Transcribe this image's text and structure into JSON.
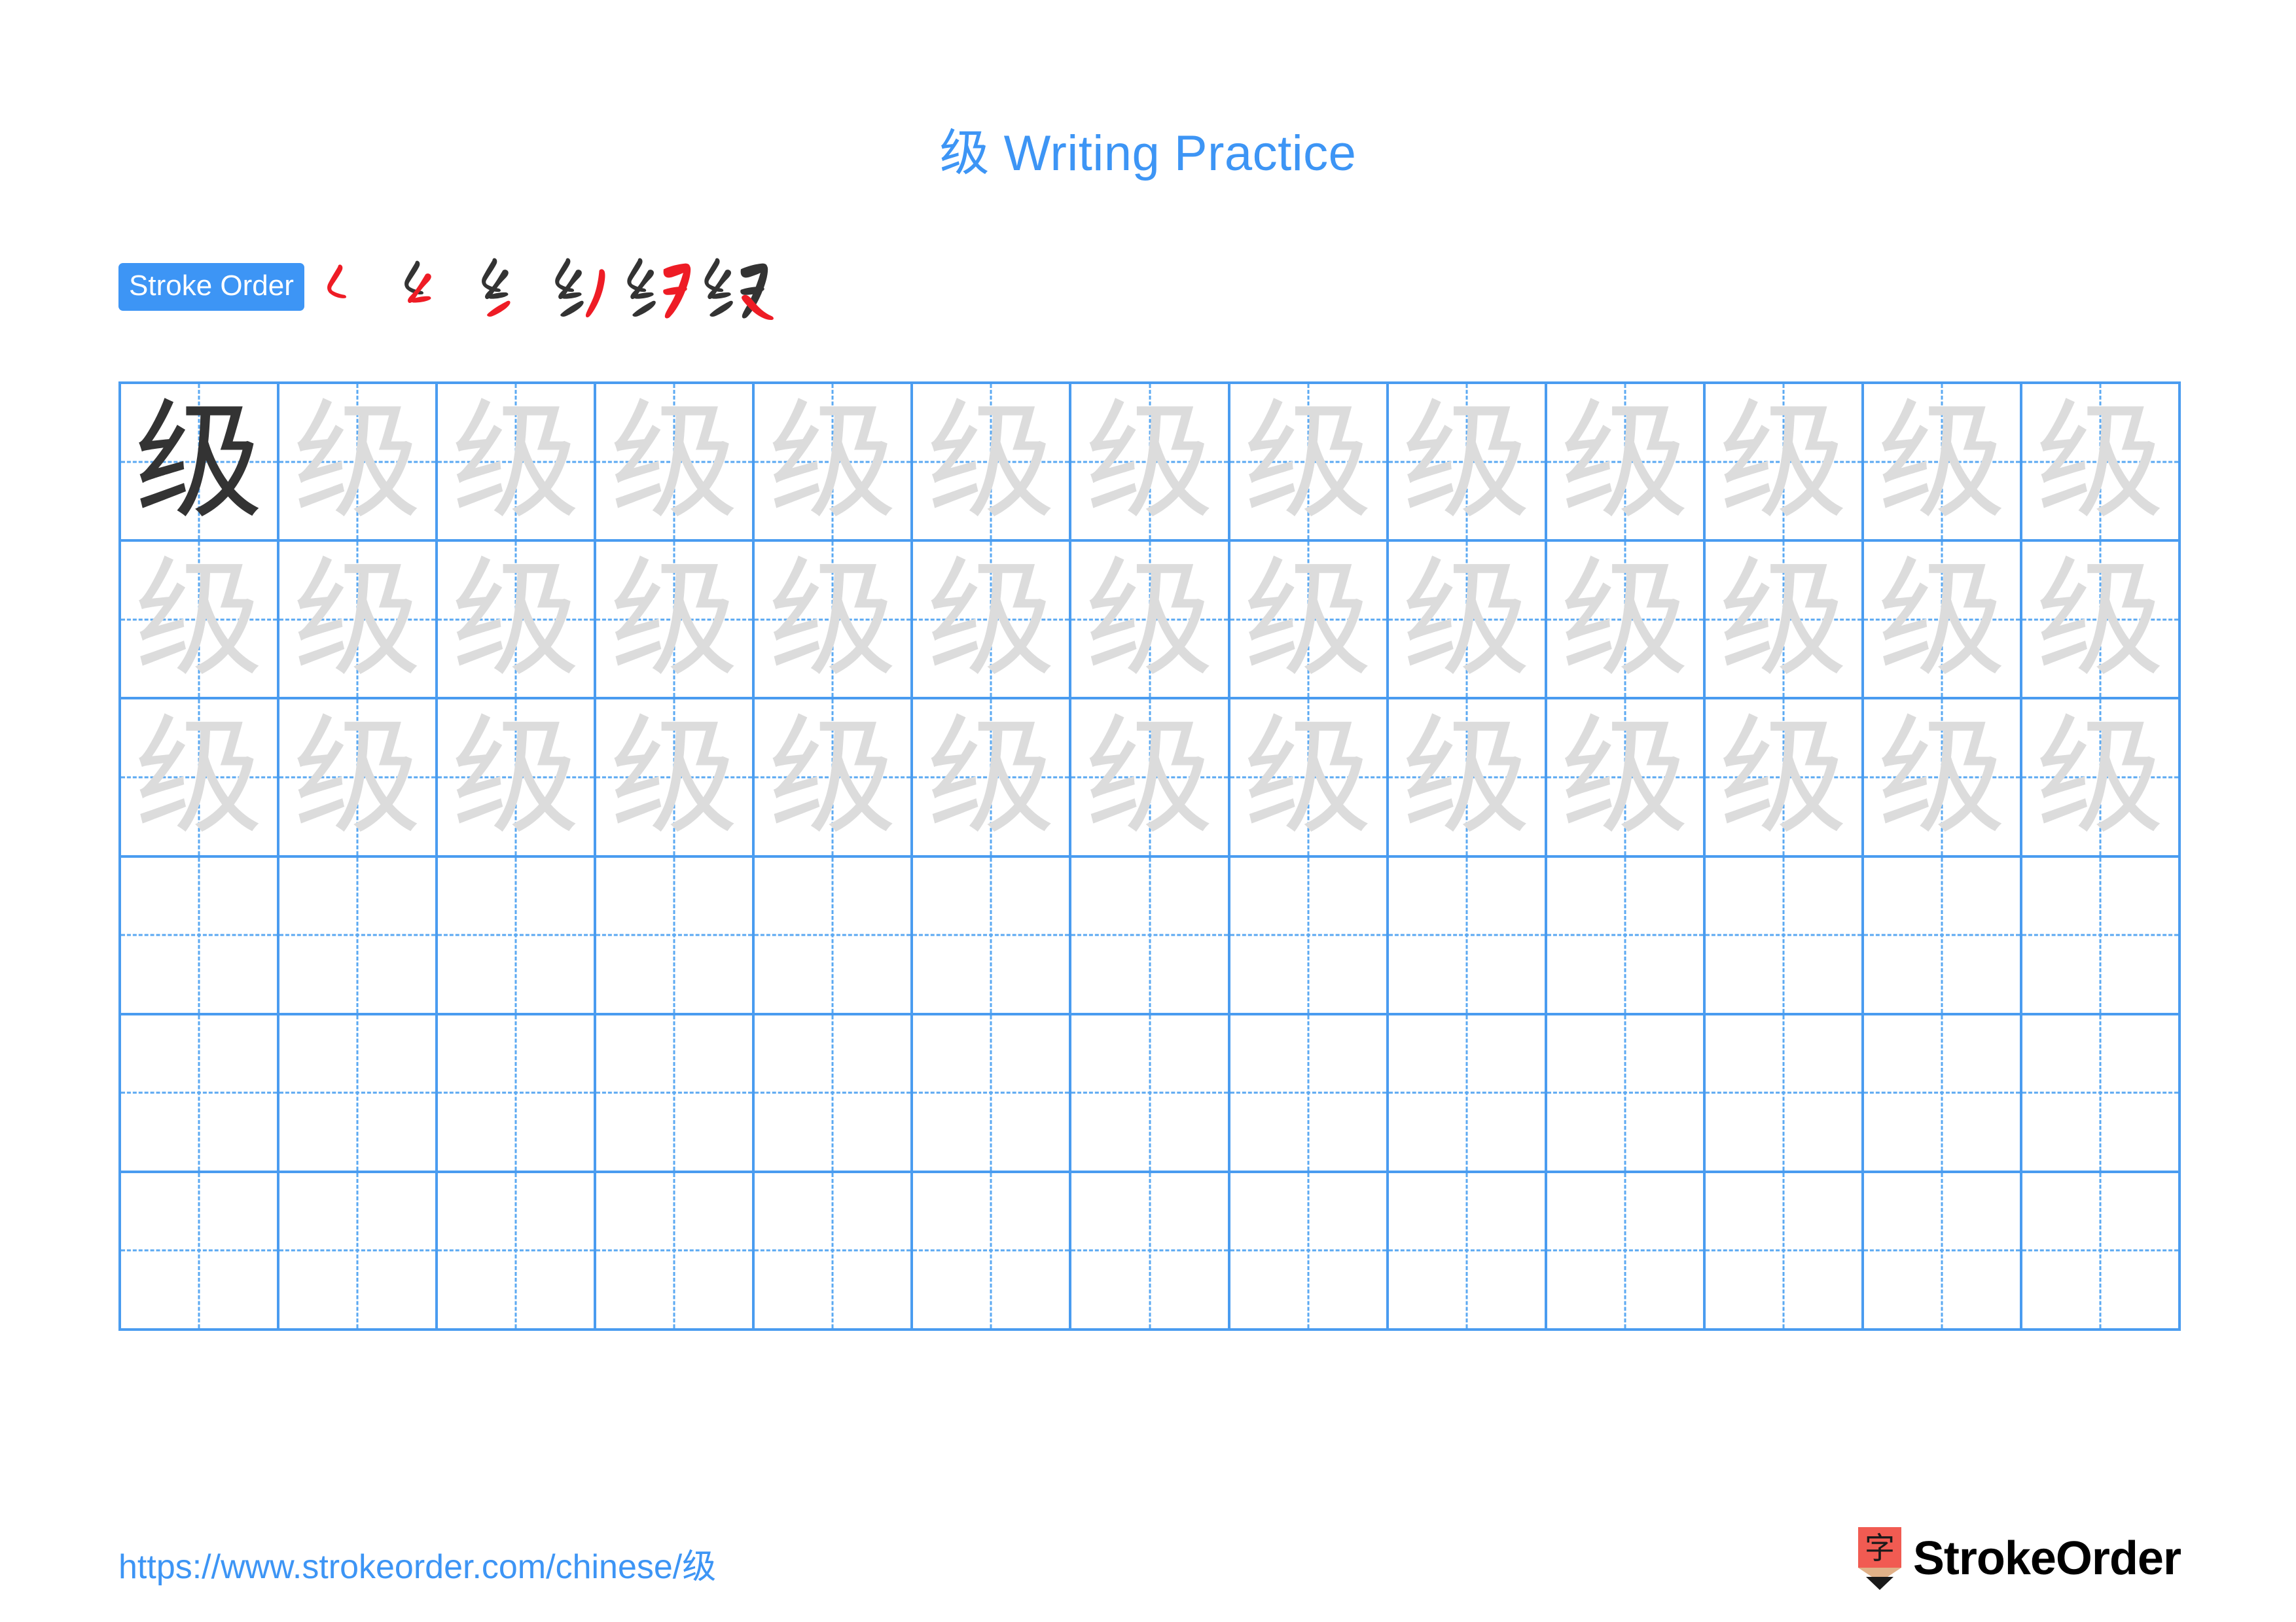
{
  "title": {
    "character": "级",
    "suffix": " Writing Practice",
    "color": "#3d95f5"
  },
  "stroke_order": {
    "badge_label": "Stroke Order",
    "badge_bg": "#3d95f5",
    "badge_text_color": "#ffffff",
    "new_stroke_color": "#ee1c25",
    "prior_stroke_color": "#333333",
    "total_strokes": 6,
    "steps": [
      {
        "step": 1,
        "label": "stroke-1"
      },
      {
        "step": 2,
        "label": "stroke-2"
      },
      {
        "step": 3,
        "label": "stroke-3"
      },
      {
        "step": 4,
        "label": "stroke-4"
      },
      {
        "step": 5,
        "label": "stroke-5"
      },
      {
        "step": 6,
        "label": "stroke-6"
      }
    ]
  },
  "grid": {
    "columns": 13,
    "rows": 6,
    "line_color": "#4a9cf0",
    "guide_color": "#5ba9f2",
    "model_char_color": "#333333",
    "trace_char_color": "#dcdcdc",
    "character": "级",
    "row_fill": [
      [
        "model",
        "trace",
        "trace",
        "trace",
        "trace",
        "trace",
        "trace",
        "trace",
        "trace",
        "trace",
        "trace",
        "trace",
        "trace"
      ],
      [
        "trace",
        "trace",
        "trace",
        "trace",
        "trace",
        "trace",
        "trace",
        "trace",
        "trace",
        "trace",
        "trace",
        "trace",
        "trace"
      ],
      [
        "trace",
        "trace",
        "trace",
        "trace",
        "trace",
        "trace",
        "trace",
        "trace",
        "trace",
        "trace",
        "trace",
        "trace",
        "trace"
      ],
      [
        "empty",
        "empty",
        "empty",
        "empty",
        "empty",
        "empty",
        "empty",
        "empty",
        "empty",
        "empty",
        "empty",
        "empty",
        "empty"
      ],
      [
        "empty",
        "empty",
        "empty",
        "empty",
        "empty",
        "empty",
        "empty",
        "empty",
        "empty",
        "empty",
        "empty",
        "empty",
        "empty"
      ],
      [
        "empty",
        "empty",
        "empty",
        "empty",
        "empty",
        "empty",
        "empty",
        "empty",
        "empty",
        "empty",
        "empty",
        "empty",
        "empty"
      ]
    ]
  },
  "footer": {
    "url_prefix": "https://www.strokeorder.com/chinese/",
    "url_character": "级",
    "url_color": "#3d95f5",
    "brand_name": "StrokeOrder",
    "logo_character": "字",
    "logo_bg_color": "#f15b52",
    "logo_tip_color": "#e0b188",
    "logo_point_color": "#1a1a1a"
  }
}
